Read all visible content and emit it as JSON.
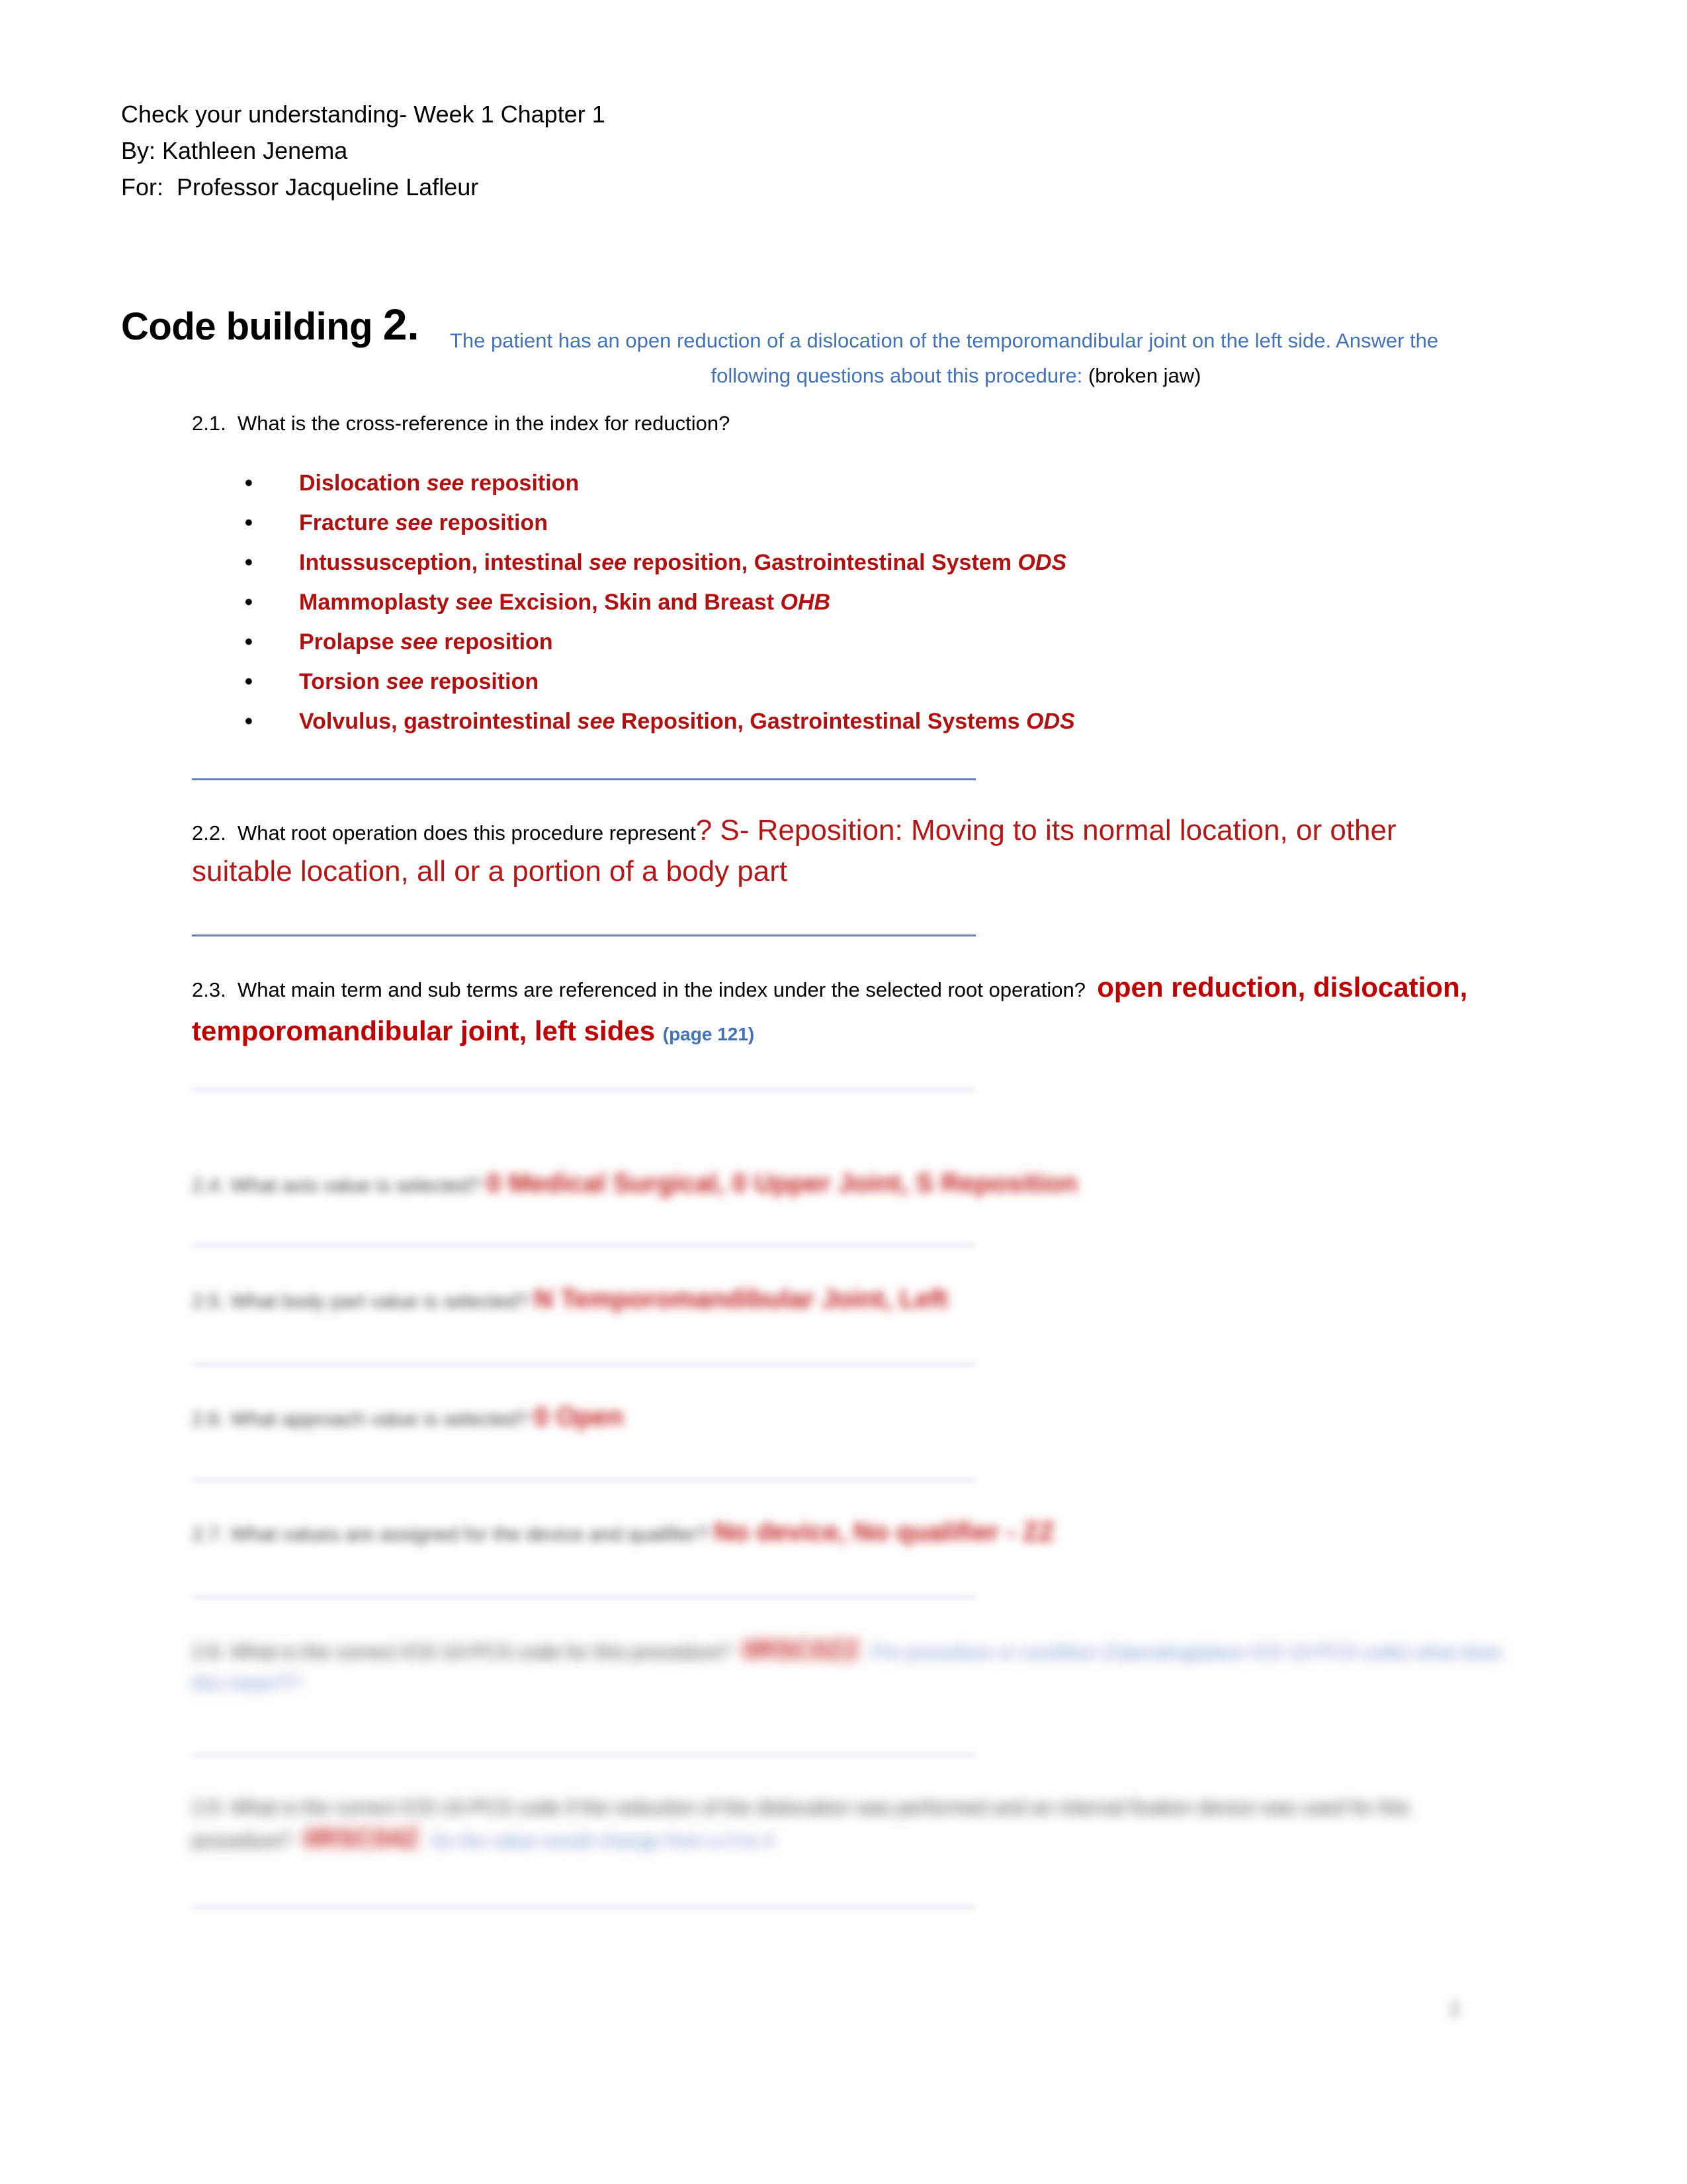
{
  "document": {
    "header_lines": [
      "Check your understanding- Week 1 Chapter 1",
      "By: Kathleen Jenema",
      "For:  Professor Jacqueline Lafleur"
    ],
    "page_number": "2"
  },
  "title": {
    "label": "Code building ",
    "number": "2.",
    "prompt_line_1": "The patient has an open reduction of a dislocation of the temporomandibular joint on the left side. Answer the",
    "prompt_line_2": "following questions about this procedure: ",
    "prompt_note": "(broken jaw)"
  },
  "questions": [
    {
      "number": "2.1.",
      "text": "What is the cross-reference in the index for reduction?"
    },
    {
      "number": "2.2.",
      "text": "What root operation does this procedure represent",
      "answer_line_1": "? S- Reposition: Moving to its normal location, or other",
      "answer_line_2": "suitable location, all or a portion of a body part"
    },
    {
      "number": "2.3.",
      "text": "What main term and sub terms are referenced in the index under the selected root operation?",
      "answer_line_1": "open reduction, dislocation,",
      "answer_line_2": "temporomandibular joint, left sides",
      "answer_note": "(page 121)"
    }
  ],
  "cross_reference_list": [
    {
      "term": "Dislocation ",
      "see": "see",
      "target": " reposition"
    },
    {
      "term": "Fracture ",
      "see": "see",
      "target": " reposition"
    },
    {
      "term": "Intussusception, intestinal ",
      "see": "see",
      "target": " reposition, Gastrointestinal System ",
      "abbr": "ODS"
    },
    {
      "term": "Mammoplasty ",
      "see": "see",
      "target": " Excision, Skin and Breast ",
      "abbr": "OHB"
    },
    {
      "term": "Prolapse ",
      "see": "see",
      "target": " reposition"
    },
    {
      "term": "Torsion ",
      "see": "see",
      "target": " reposition"
    },
    {
      "term": "Volvulus, gastrointestinal ",
      "see": "see",
      "target": " Reposition, Gastrointestinal Systems ",
      "abbr": "ODS"
    }
  ],
  "bullet_glyph": "•",
  "redacted_rows": [
    {
      "question": "2.4.  What axis value is selected?",
      "answer": "0 Medical Surgical, 0 Upper Joint, S  Reposition",
      "blue": ""
    },
    {
      "question": "2.5.  What body part value is selected?",
      "answer": "N  Temporomandibular Joint, Left",
      "blue": ""
    },
    {
      "question": "2.6.  What approach value is selected?",
      "answer": "0  Open",
      "blue": ""
    },
    {
      "question": "2.7.  What values are assigned for the device and qualifier?",
      "answer": "No device, No qualifier - ZZ",
      "blue": ""
    },
    {
      "question": "2.8.  What is the correct ICD-10-PCS code for this procedure?",
      "answer": "0RSC0ZZ",
      "blue": "Pre procedure or condition (Operating/place ICD-10-PCS code)  what does this mean?!?"
    },
    {
      "question": "2.9.  What is the correct ICD-10-PCS code if the reduction of the dislocation was performed and an internal fixation device was used for this procedure?",
      "answer": "0RSC04Z",
      "blue": "So the value would change from a 0 to 4"
    }
  ],
  "colors": {
    "prompt_blue": "#4472b8",
    "answer_red": "#b51717",
    "list_red": "#b11010",
    "bold_red": "#c00000",
    "divider": "#4a6fa8"
  }
}
